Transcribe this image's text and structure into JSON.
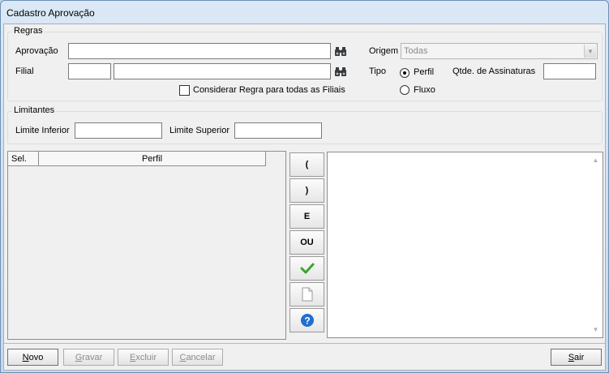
{
  "window": {
    "title": "Cadastro Aprovação"
  },
  "regras": {
    "legend": "Regras",
    "aprovacao_label": "Aprovação",
    "aprovacao_value": "",
    "filial_label": "Filial",
    "filial_code_value": "",
    "filial_name_value": "",
    "considerar_label": "Considerar Regra para todas as Filiais",
    "considerar_checked": false,
    "origem_label": "Origem",
    "origem_value": "Todas",
    "tipo_label": "Tipo",
    "tipo_options": [
      {
        "label": "Perfil",
        "selected": true
      },
      {
        "label": "Fluxo",
        "selected": false
      }
    ],
    "qtde_label": "Qtde. de Assinaturas",
    "qtde_value": ""
  },
  "limitantes": {
    "legend": "Limitantes",
    "inferior_label": "Limite Inferior",
    "inferior_value": "",
    "superior_label": "Limite Superior",
    "superior_value": ""
  },
  "grid": {
    "columns": [
      "Sel.",
      "Perfil"
    ]
  },
  "side_buttons": {
    "open_paren": "(",
    "close_paren": ")",
    "and": "E",
    "or": "OU"
  },
  "buttons": {
    "novo": {
      "first": "N",
      "rest": "ovo"
    },
    "gravar": {
      "first": "G",
      "rest": "ravar"
    },
    "excluir": {
      "first": "E",
      "rest": "xcluir"
    },
    "cancelar": {
      "first": "C",
      "rest": "ancelar"
    },
    "sair": {
      "first": "S",
      "rest": "air"
    }
  },
  "colors": {
    "check_green": "#3aa52c",
    "help_blue": "#1f6fd1"
  }
}
